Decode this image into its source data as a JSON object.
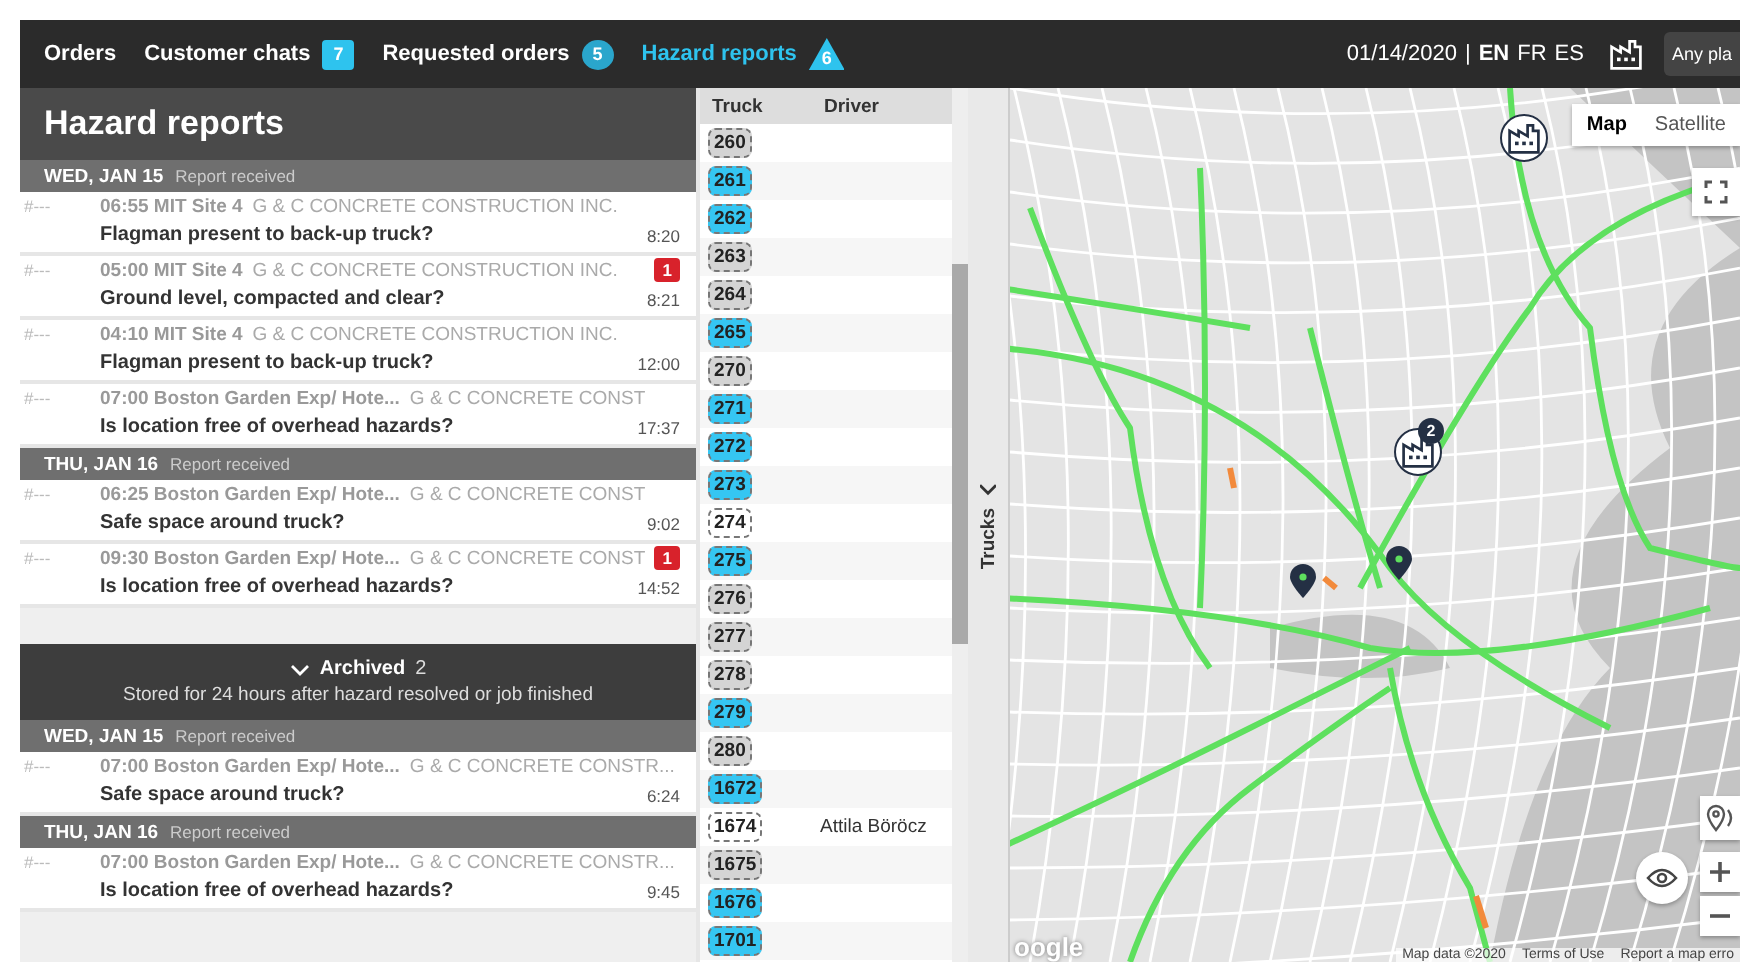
{
  "top_bar": {
    "tabs": [
      {
        "label": "Orders",
        "selected": false
      },
      {
        "label": "Customer chats",
        "selected": false,
        "badge": "7",
        "kind": "square"
      },
      {
        "label": "Requested orders",
        "selected": false,
        "badge": "5",
        "kind": "circle"
      },
      {
        "label": "Hazard reports",
        "selected": true,
        "badge": "6",
        "kind": "triangle"
      }
    ],
    "date": "01/14/2020",
    "separator": "|",
    "languages": [
      {
        "label": "EN",
        "selected": true
      },
      {
        "label": "FR",
        "selected": false
      },
      {
        "label": "ES",
        "selected": false
      }
    ],
    "plant_button": "Any pla"
  },
  "hazard_panel": {
    "title": "Hazard reports",
    "groups": [
      {
        "day": "WED, JAN 15",
        "note": "Report received",
        "reports": [
          {
            "id": "#---",
            "time": "06:55",
            "site": "MIT Site 4",
            "company": "G & C CONCRETE CONSTRUCTION INC.",
            "question": "Flagman present to back-up truck?",
            "duration": "8:20"
          },
          {
            "id": "#---",
            "time": "05:00",
            "site": "MIT Site 4",
            "company": "G & C CONCRETE CONSTRUCTION INC.",
            "question": "Ground level, compacted and clear?",
            "duration": "8:21",
            "alerts": "1"
          },
          {
            "id": "#---",
            "time": "04:10",
            "site": "MIT Site 4",
            "company": "G & C CONCRETE CONSTRUCTION INC.",
            "question": "Flagman present to back-up truck?",
            "duration": "12:00"
          },
          {
            "id": "#---",
            "time": "07:00",
            "site": "Boston Garden Exp/ Hote...",
            "company": "G & C CONCRETE CONST",
            "question": "Is location free of overhead hazards?",
            "duration": "17:37"
          }
        ]
      },
      {
        "day": "THU, JAN 16",
        "note": "Report received",
        "reports": [
          {
            "id": "#---",
            "time": "06:25",
            "site": "Boston Garden Exp/ Hote...",
            "company": "G & C CONCRETE CONST",
            "question": "Safe space around truck?",
            "duration": "9:02"
          },
          {
            "id": "#---",
            "time": "09:30",
            "site": "Boston Garden Exp/ Hote...",
            "company": "G & C CONCRETE CONST",
            "question": "Is location free of overhead hazards?",
            "duration": "14:52",
            "alerts": "1"
          }
        ]
      }
    ],
    "archive": {
      "label": "Archived",
      "count": "2",
      "expanded": true,
      "note": "Stored for 24 hours after hazard resolved or job finished",
      "groups": [
        {
          "day": "WED, JAN 15",
          "note": "Report received",
          "reports": [
            {
              "id": "#---",
              "time": "07:00",
              "site": "Boston Garden Exp/ Hote...",
              "company": "G & C CONCRETE CONSTR...",
              "question": "Safe space around truck?",
              "duration": "6:24"
            }
          ]
        },
        {
          "day": "THU, JAN 16",
          "note": "Report received",
          "reports": [
            {
              "id": "#---",
              "time": "07:00",
              "site": "Boston Garden Exp/ Hote...",
              "company": "G & C CONCRETE CONSTR...",
              "question": "Is location free of overhead hazards?",
              "duration": "9:45"
            }
          ]
        }
      ]
    }
  },
  "trucks_panel": {
    "columns": [
      "Truck",
      "Driver"
    ],
    "tab_label": "Trucks",
    "rows": [
      {
        "truck": "260",
        "color": "#d4d4d4"
      },
      {
        "truck": "261",
        "color": "#35c6f2"
      },
      {
        "truck": "262",
        "color": "#35c6f2"
      },
      {
        "truck": "263",
        "color": "#d4d4d4"
      },
      {
        "truck": "264",
        "color": "#d4d4d4"
      },
      {
        "truck": "265",
        "color": "#35c6f2"
      },
      {
        "truck": "270",
        "color": "#d4d4d4"
      },
      {
        "truck": "271",
        "color": "#35c6f2"
      },
      {
        "truck": "272",
        "color": "#35c6f2"
      },
      {
        "truck": "273",
        "color": "#35c6f2"
      },
      {
        "truck": "274",
        "color": "#ffffff"
      },
      {
        "truck": "275",
        "color": "#35c6f2"
      },
      {
        "truck": "276",
        "color": "#d4d4d4"
      },
      {
        "truck": "277",
        "color": "#d4d4d4"
      },
      {
        "truck": "278",
        "color": "#d4d4d4"
      },
      {
        "truck": "279",
        "color": "#35c6f2"
      },
      {
        "truck": "280",
        "color": "#d4d4d4"
      },
      {
        "truck": "1672",
        "color": "#35c6f2"
      },
      {
        "truck": "1674",
        "color": "#ffffff",
        "driver": "Attila Böröcz"
      },
      {
        "truck": "1675",
        "color": "#d4d4d4"
      },
      {
        "truck": "1676",
        "color": "#35c6f2"
      },
      {
        "truck": "1701",
        "color": "#35c6f2"
      }
    ]
  },
  "map": {
    "map_types": [
      {
        "label": "Map",
        "selected": true
      },
      {
        "label": "Satellite",
        "selected": false
      }
    ],
    "cluster_count": "2",
    "logo": "oogle",
    "attribution": [
      "Map data ©2020",
      "Terms of Use",
      "Report a map erro"
    ]
  }
}
